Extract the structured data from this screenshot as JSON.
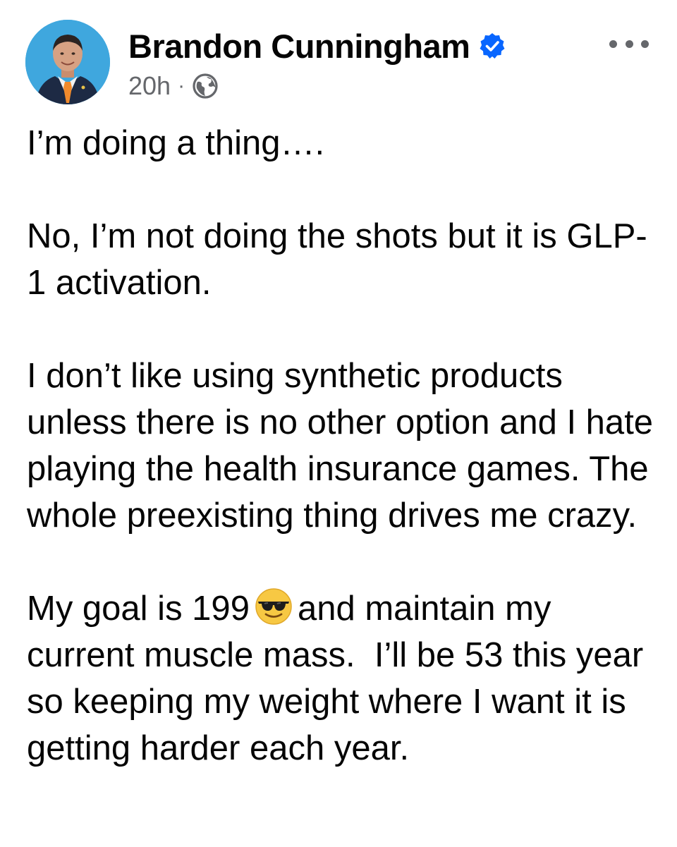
{
  "post": {
    "author": {
      "name": "Brandon Cunningham",
      "verified": true,
      "avatar_icon": "profile-photo"
    },
    "meta": {
      "timestamp": "20h",
      "separator": "·",
      "audience_icon": "globe-icon"
    },
    "menu_icon": "more-horizontal-icon",
    "paragraphs": [
      "I’m doing a thing….",
      "No, I’m not doing the shots but it is GLP-1 activation.",
      "I don’t like using synthetic products unless there is no other option and I hate playing the health insurance games. The whole preexisting thing drives me crazy."
    ],
    "last_paragraph": {
      "before_emoji": "My goal is 199",
      "emoji": "😎",
      "after_emoji": "and maintain my current muscle mass.  I’ll be 53 this year so keeping my weight where I want it is getting harder each year."
    }
  },
  "colors": {
    "text": "#050505",
    "secondary": "#65676b",
    "verified": "#0866ff",
    "avatar_bg": "#3fa7de"
  }
}
